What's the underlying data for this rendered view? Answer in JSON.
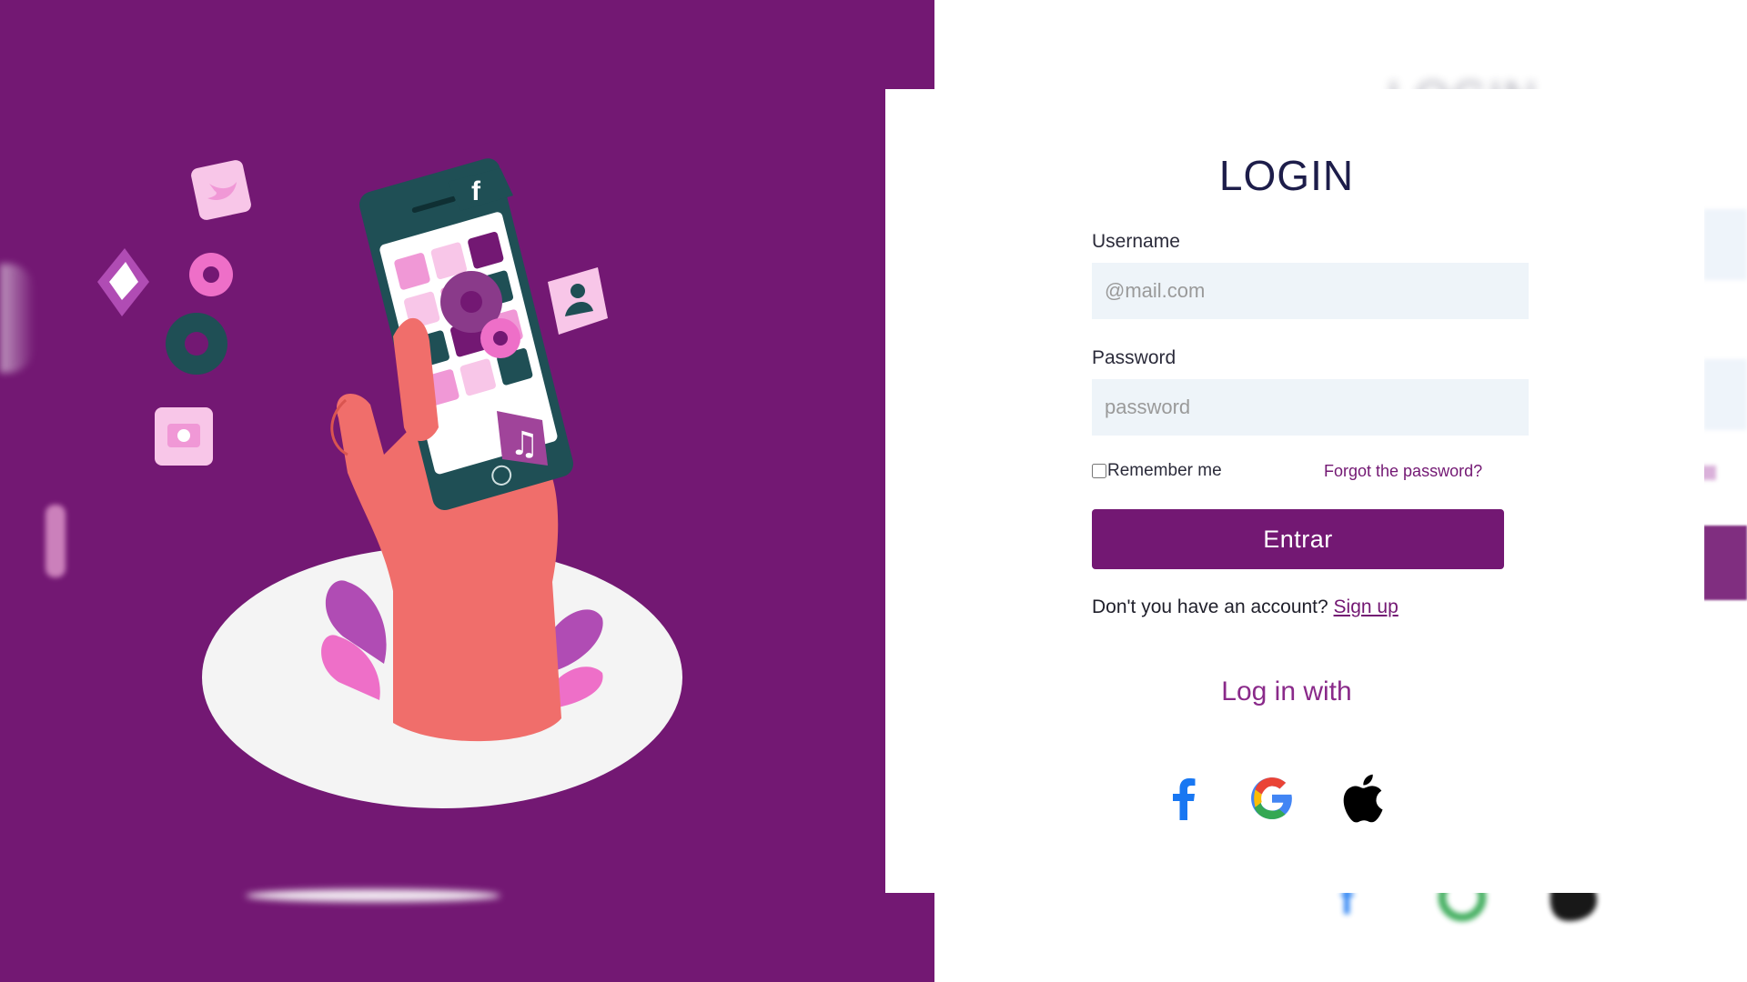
{
  "login": {
    "title": "LOGIN",
    "username": {
      "label": "Username",
      "placeholder": "@mail.com",
      "value": ""
    },
    "password": {
      "label": "Password",
      "placeholder": "password",
      "value": ""
    },
    "remember_label": "Remember me",
    "forgot_label": "Forgot the password?",
    "submit_label": "Entrar",
    "signup_prompt": "Don't you have an account?",
    "signup_link": "Sign up",
    "social_heading": "Log in with",
    "social": [
      {
        "name": "facebook-icon"
      },
      {
        "name": "google-icon"
      },
      {
        "name": "apple-icon"
      }
    ]
  },
  "colors": {
    "brand": "#731873",
    "input_bg": "#eef4f9",
    "title": "#1d1d4a",
    "facebook": "#1877f2"
  }
}
